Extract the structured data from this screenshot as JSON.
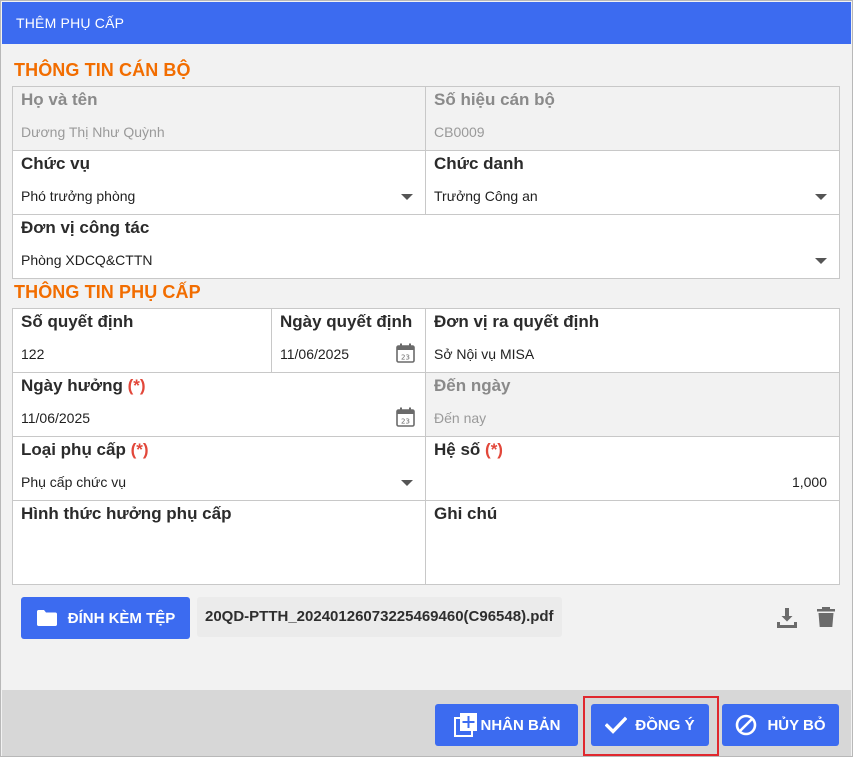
{
  "dialog": {
    "title": "THÊM PHỤ CẤP"
  },
  "staff_info": {
    "section_title": "THÔNG TIN CÁN BỘ",
    "full_name": {
      "label": "Họ và tên",
      "value": "Dương Thị Như Quỳnh"
    },
    "staff_code": {
      "label": "Số hiệu cán bộ",
      "value": "CB0009"
    },
    "position": {
      "label": "Chức vụ",
      "value": "Phó trưởng phòng"
    },
    "title_field": {
      "label": "Chức danh",
      "value": "Trưởng Công an"
    },
    "unit": {
      "label": "Đơn vị công tác",
      "value": "Phòng XDCQ&CTTN"
    }
  },
  "allowance_info": {
    "section_title": "THÔNG TIN PHỤ CẤP",
    "decision_no": {
      "label": "Số quyết định",
      "value": "122"
    },
    "decision_date": {
      "label": "Ngày quyết định",
      "value": "11/06/2025"
    },
    "issuing_unit": {
      "label": "Đơn vị ra quyết định",
      "value": "Sở Nội vụ MISA"
    },
    "start_date": {
      "label": "Ngày hưởng",
      "required": "(*)",
      "value": "11/06/2025"
    },
    "end_date": {
      "label": "Đến ngày",
      "placeholder": "Đến nay"
    },
    "allowance_type": {
      "label": "Loại phụ cấp",
      "required": "(*)",
      "value": "Phụ cấp chức vụ"
    },
    "coefficient": {
      "label": "Hệ số",
      "required": "(*)",
      "value": "1,000"
    },
    "method": {
      "label": "Hình thức hưởng phụ cấp",
      "value": ""
    },
    "note": {
      "label": "Ghi chú",
      "value": ""
    }
  },
  "attachment": {
    "button_label": "ĐÍNH KÈM TỆP",
    "file_name": "20QD-PTTH_20240126073225469460(C96548).pdf"
  },
  "footer": {
    "duplicate_label": "NHÂN BẢN",
    "confirm_label": "ĐỒNG Ý",
    "cancel_label": "HỦY BỎ"
  },
  "calendar_day": "23",
  "colors": {
    "primary": "#3c6bf0",
    "section_title": "#f26d00",
    "required": "#e2473a",
    "highlight": "#e0282e"
  }
}
